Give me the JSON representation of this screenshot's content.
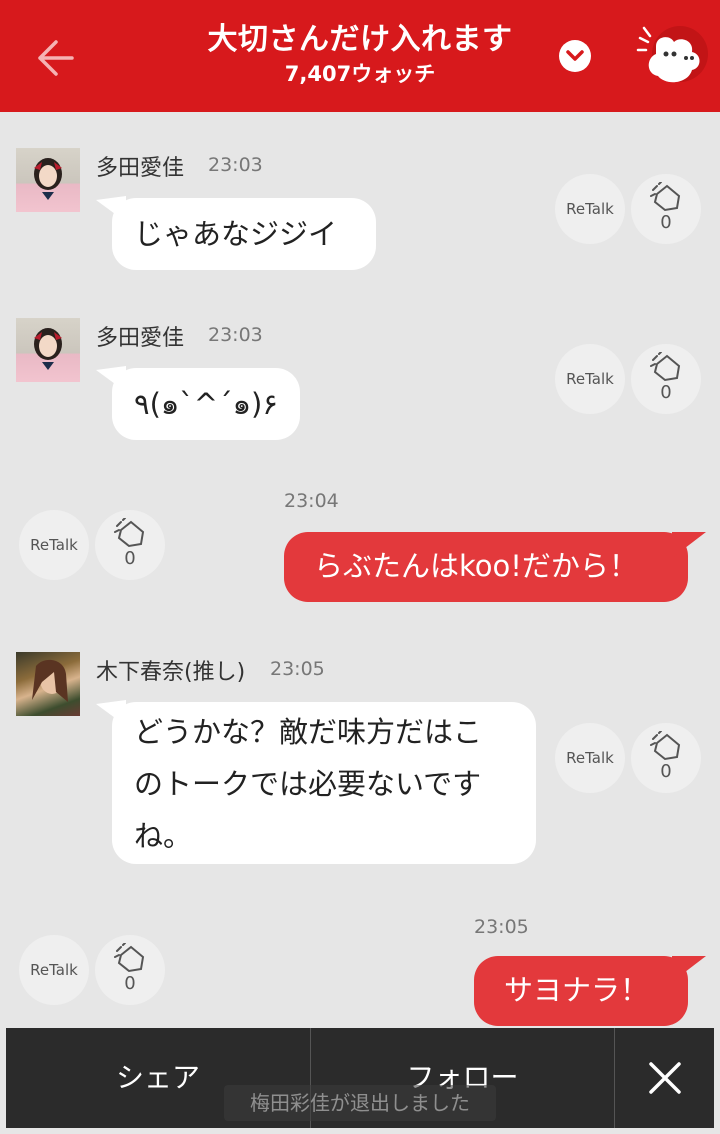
{
  "header": {
    "title": "大切さんだけ入れます",
    "watch_count": "7,407ウォッチ",
    "color": "#d7191c"
  },
  "messages": [
    {
      "name": "多田愛佳",
      "time": "23:03",
      "text": "じゃあなジジイ",
      "retalk": "ReTalk",
      "claps": "0"
    },
    {
      "name": "多田愛佳",
      "time": "23:03",
      "text": "٩(๑`^´๑)۶",
      "retalk": "ReTalk",
      "claps": "0"
    },
    {
      "time": "23:04",
      "text": "らぶたんはkoo!だから！",
      "retalk": "ReTalk",
      "claps": "0"
    },
    {
      "name": "木下春奈(推し)",
      "time": "23:05",
      "text_lines": [
        "どうかな？敵だ味方だはこ",
        "のトークでは必要ないです",
        "ね。"
      ],
      "retalk": "ReTalk",
      "claps": "0"
    },
    {
      "time": "23:05",
      "text": "サヨナラ！",
      "retalk": "ReTalk",
      "claps": "0"
    }
  ],
  "bottom_bar": {
    "share": "シェア",
    "follow": "フォロー"
  },
  "toast": "梅田彩佳が退出しました",
  "icons": {
    "back": "back-arrow-icon",
    "dropdown": "chevron-down-icon",
    "mascot": "mascot-icon",
    "clap": "clap-icon",
    "close": "close-icon"
  },
  "colors": {
    "accent": "#d7191c",
    "bubble_out": "#e3393c",
    "background": "#e6e6e6"
  }
}
